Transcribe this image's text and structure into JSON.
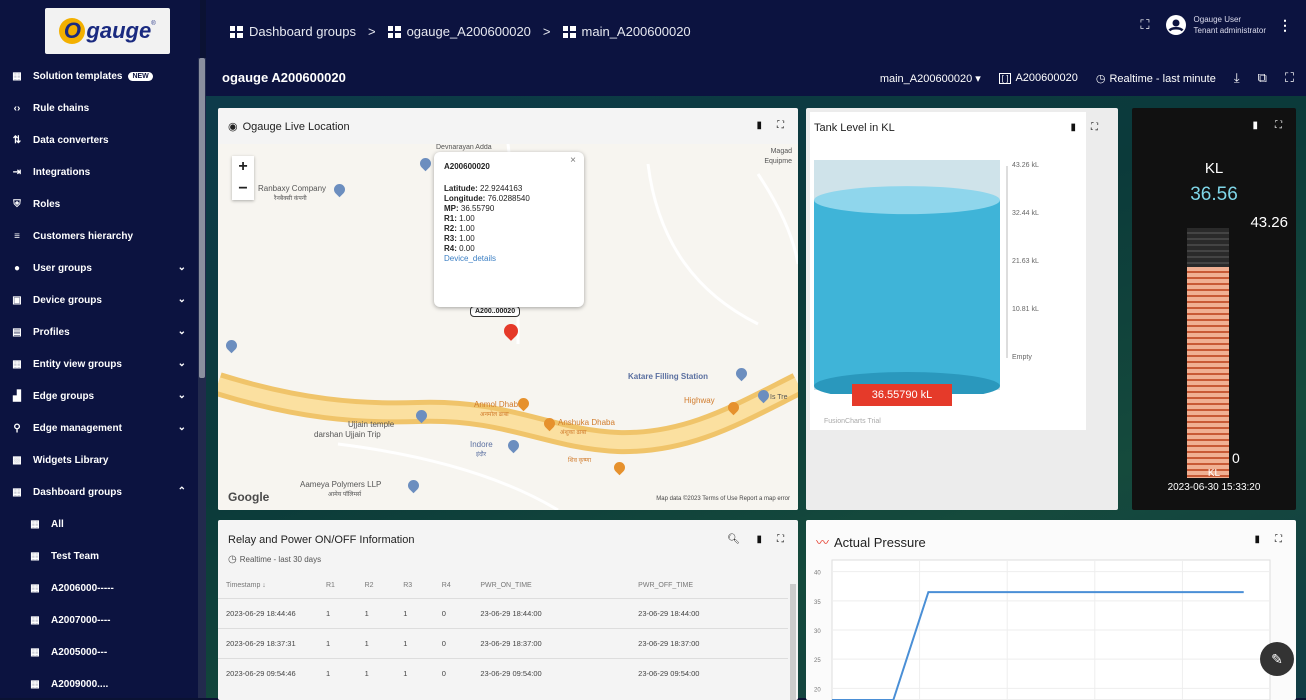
{
  "logo": {
    "text": "gauge",
    "mark": "O"
  },
  "sidebar": {
    "items": [
      {
        "label": "Solution templates",
        "icon": "grid-icon",
        "badge": "NEW"
      },
      {
        "label": "Rule chains",
        "icon": "code-arrows-icon"
      },
      {
        "label": "Data converters",
        "icon": "transform-icon"
      },
      {
        "label": "Integrations",
        "icon": "input-icon"
      },
      {
        "label": "Roles",
        "icon": "shield-icon"
      },
      {
        "label": "Customers hierarchy",
        "icon": "hierarchy-icon"
      },
      {
        "label": "User groups",
        "icon": "account-icon",
        "chevron": "⌄"
      },
      {
        "label": "Device groups",
        "icon": "devices-icon",
        "chevron": "⌄"
      },
      {
        "label": "Profiles",
        "icon": "briefcase-icon",
        "chevron": "⌄"
      },
      {
        "label": "Entity view groups",
        "icon": "table-icon",
        "chevron": "⌄"
      },
      {
        "label": "Edge groups",
        "icon": "router-icon",
        "chevron": "⌄"
      },
      {
        "label": "Edge management",
        "icon": "antenna-icon",
        "chevron": "⌄"
      },
      {
        "label": "Widgets Library",
        "icon": "widgets-icon"
      },
      {
        "label": "Dashboard groups",
        "icon": "dashboard-icon",
        "chevron": "⌃"
      }
    ],
    "subitems": [
      {
        "label": "All"
      },
      {
        "label": "Test Team"
      },
      {
        "label": "A2006000-----"
      },
      {
        "label": "A2007000----"
      },
      {
        "label": "A2005000---"
      },
      {
        "label": "A2009000...."
      }
    ]
  },
  "breadcrumb": {
    "items": [
      "Dashboard groups",
      "ogauge_A200600020",
      "main_A200600020"
    ],
    "separator": ">"
  },
  "user": {
    "name": "Ogauge User",
    "role": "Tenant administrator"
  },
  "dashboard": {
    "title": "ogauge A200600020",
    "state_select": "main_A200600020",
    "entity": "A200600020",
    "timewindow": "Realtime - last minute"
  },
  "map_widget": {
    "title": "Ogauge Live Location",
    "popup": {
      "title": "A200600020",
      "close": "×",
      "lines": [
        {
          "k": "Latitude:",
          "v": "22.9244163"
        },
        {
          "k": "Longitude:",
          "v": "76.0288540"
        },
        {
          "k": "MP:",
          "v": "36.55790"
        },
        {
          "k": "R1:",
          "v": "1.00"
        },
        {
          "k": "R2:",
          "v": "1.00"
        },
        {
          "k": "R3:",
          "v": "1.00"
        },
        {
          "k": "R4:",
          "v": "0.00"
        }
      ],
      "link": "Device_details"
    },
    "marker_label": "A200..00020",
    "labels": {
      "ranbaxy": "Ranbaxy Company",
      "ranbaxy_sub": "रैनबैक्सी कंपनी",
      "katare": "Katare Filling Station",
      "ujjain": "Ujjain temple",
      "ujjain_sub": "darshan Ujjain Trip",
      "anmol": "Anmol Dhaba",
      "anmol_sub": "अनमोल ढाबा",
      "anshuka": "Anshuka Dhaba",
      "anshuka_sub": "अंशुका ढाबा",
      "highway": "Highway",
      "indore": "Indore",
      "indore_sub": "इंदौर",
      "aameya": "Aameya Polymers LLP",
      "aameya_sub": "आमेय पॉलिमर्स",
      "magad": "Magad",
      "magad_sub": "Equipme",
      "devnarayan": "Devnarayan Adda",
      "shiv": "शिव कृष्णा",
      "is_tre": "Is Tre"
    },
    "google": "Google",
    "attribution": "Map data ©2023   Terms of Use   Report a map error"
  },
  "tank_widget": {
    "title": "Tank Level in KL",
    "scale": [
      "43.26 kL",
      "32.44 kL",
      "21.63 kL",
      "10.81 kL",
      "Empty"
    ],
    "value_label": "36.55790 kL",
    "credit": "FusionCharts Trial",
    "level": 0.845
  },
  "kl_widget": {
    "unit_top": "KL",
    "value": "36.56",
    "max": "43.26",
    "min": "0",
    "unit_bottom": "KL",
    "timestamp": "2023-06-30 15:33:20",
    "level": 0.845
  },
  "relay_widget": {
    "title": "Relay and Power ON/OFF Information",
    "timewindow": "Realtime - last 30 days",
    "columns": [
      "Timestamp ↓",
      "R1",
      "R2",
      "R3",
      "R4",
      "PWR_ON_TIME",
      "PWR_OFF_TIME"
    ],
    "rows": [
      [
        "2023-06-29 18:44:46",
        "1",
        "1",
        "1",
        "0",
        "23-06-29 18:44:00",
        "23-06-29 18:44:00"
      ],
      [
        "2023-06-29 18:37:31",
        "1",
        "1",
        "1",
        "0",
        "23-06-29 18:37:00",
        "23-06-29 18:37:00"
      ],
      [
        "2023-06-29 09:54:46",
        "1",
        "1",
        "1",
        "0",
        "23-06-29 09:54:00",
        "23-06-29 09:54:00"
      ]
    ]
  },
  "pressure_widget": {
    "title": "Actual Pressure",
    "y_ticks": [
      "40",
      "35",
      "30",
      "25",
      "20"
    ],
    "ylim": [
      18,
      42
    ],
    "series": [
      [
        0.0,
        18
      ],
      [
        0.14,
        18
      ],
      [
        0.22,
        36.5
      ],
      [
        0.94,
        36.5
      ]
    ]
  },
  "colors": {
    "nav_bg": "#0c1340",
    "tank_fill": "#3fb4d8",
    "value_box": "#e53a2a",
    "line": "#4a8fd6"
  }
}
